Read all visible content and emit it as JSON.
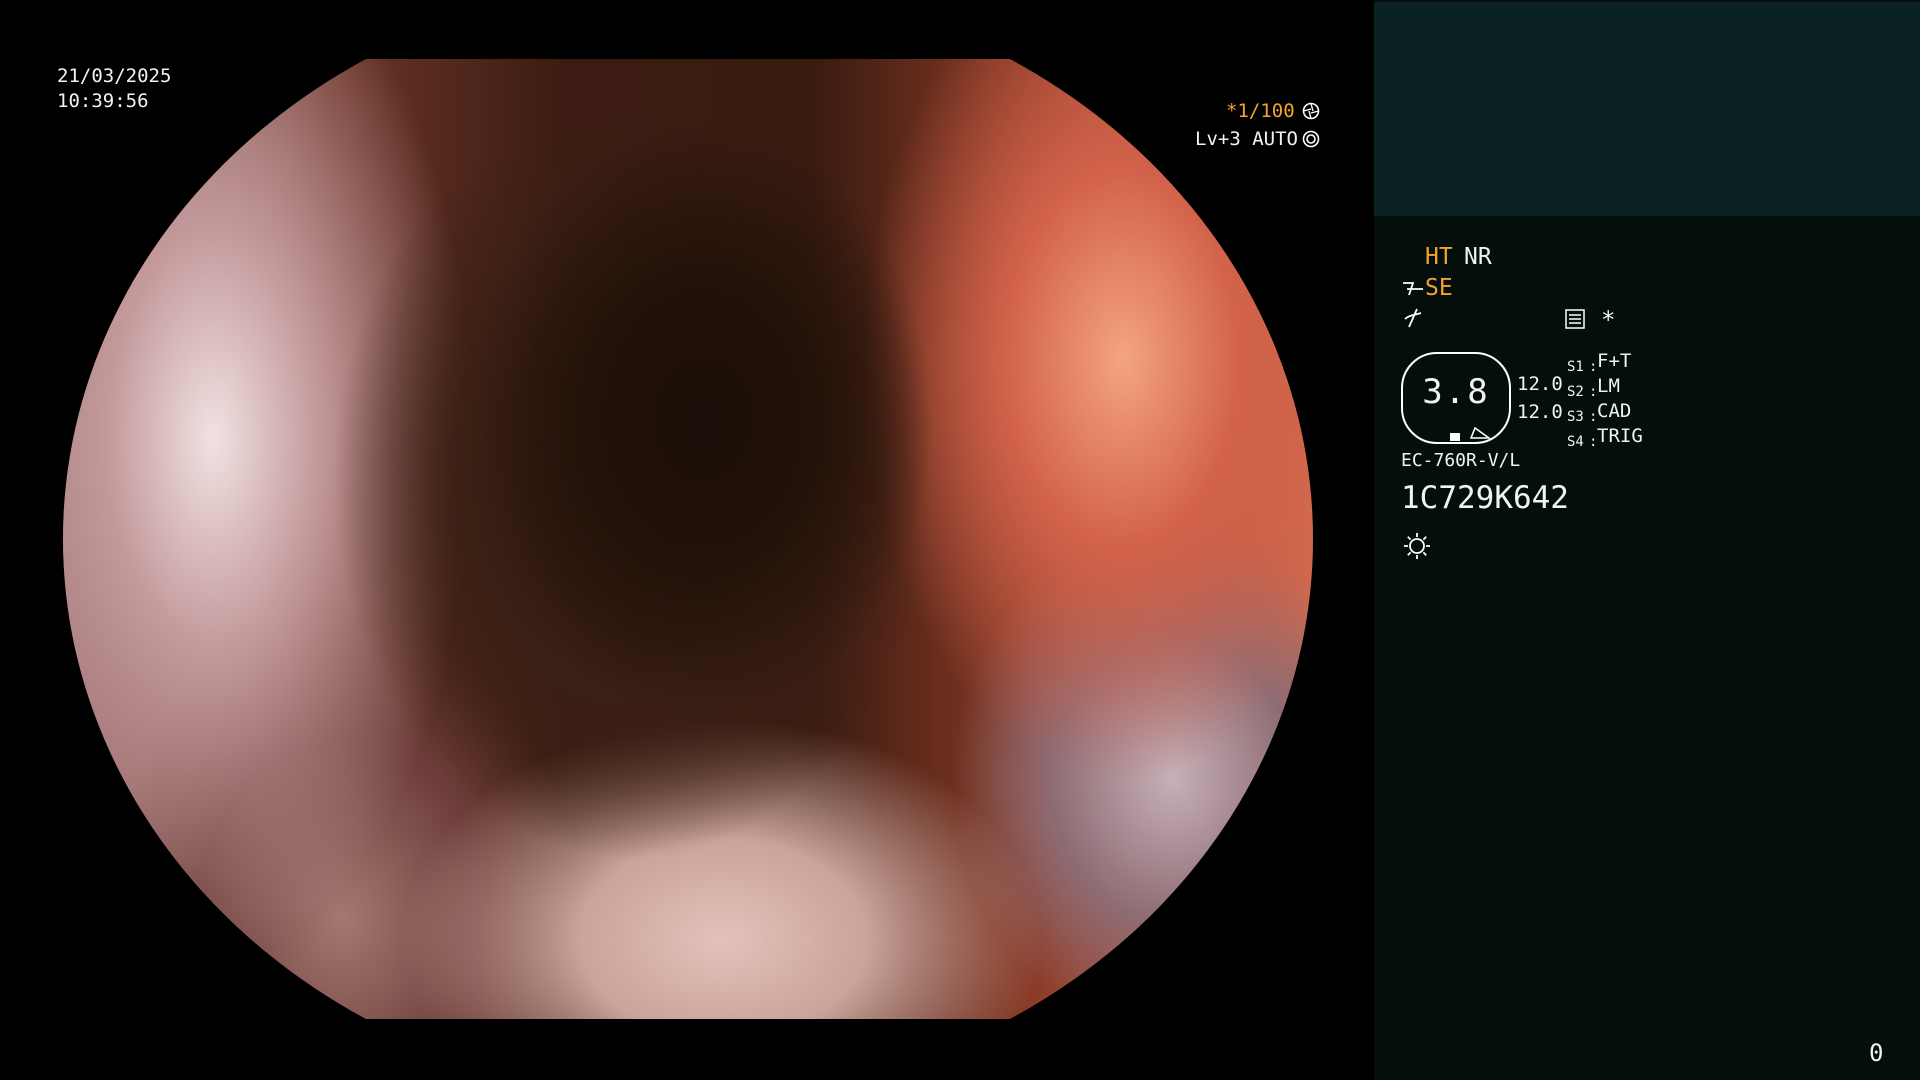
{
  "datetime": {
    "date": "21/03/2025",
    "time": "10:39:56"
  },
  "exposure": {
    "shutter": "*1/100",
    "level": "Lv+3 AUTO"
  },
  "modes": {
    "ht": "HT",
    "nr": "NR",
    "se": "SE",
    "asterisk": "*"
  },
  "gauge": {
    "value": "3.8",
    "readout_top": "12.0",
    "readout_bottom": "12.0"
  },
  "switches": [
    {
      "key": "S1",
      "value": "F+T"
    },
    {
      "key": "S2",
      "value": "LM"
    },
    {
      "key": "S3",
      "value": "CAD"
    },
    {
      "key": "S4",
      "value": "TRIG"
    }
  ],
  "scope": {
    "model": "EC-760R-V/L",
    "serial": "1C729K642"
  },
  "counter": "0",
  "colors": {
    "accent": "#f2a52a",
    "panel_bg": "#030e0d",
    "panel_top": "#0b2223",
    "text": "#f2f2f2"
  },
  "icons": [
    "iris-icon",
    "auto-level-icon",
    "scope-angle-icon",
    "enhance-icon",
    "menu-list-icon",
    "light-icon"
  ]
}
